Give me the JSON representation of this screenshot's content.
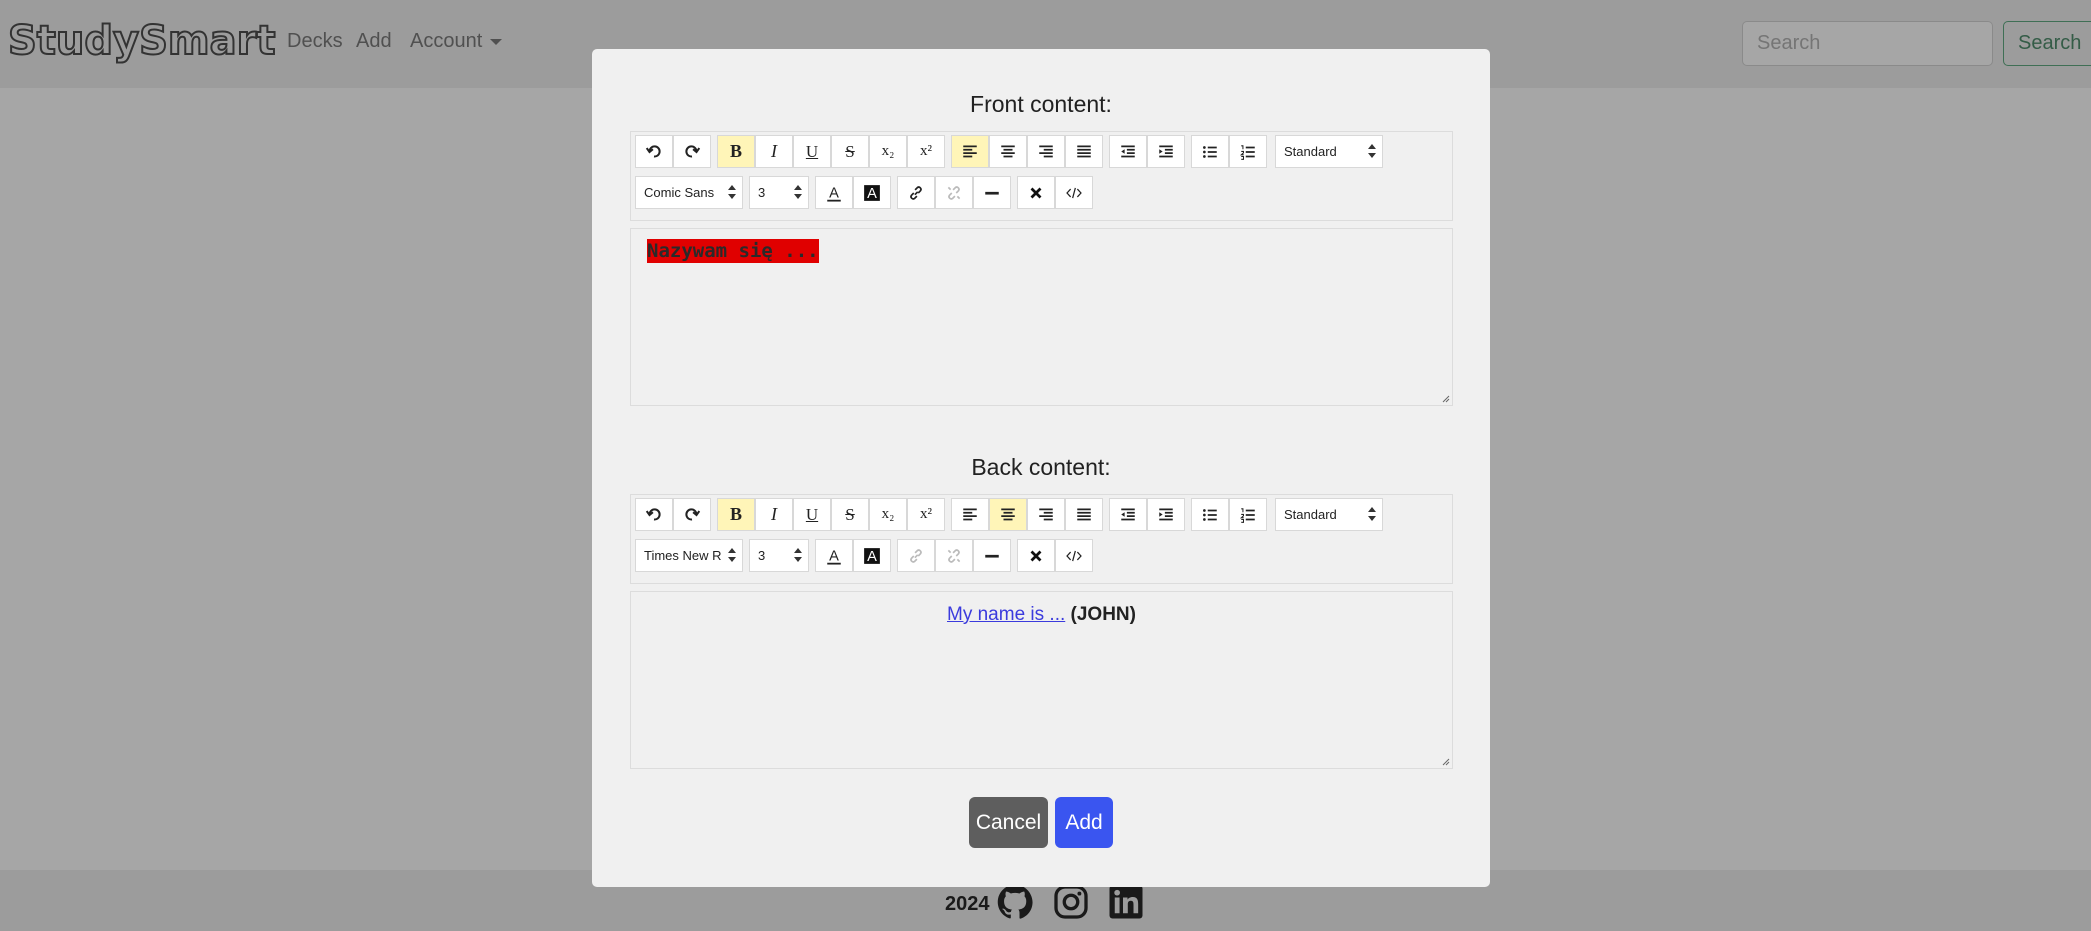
{
  "navbar": {
    "brand": "StudySmart",
    "links": [
      "Decks",
      "Add",
      "Account"
    ],
    "search_placeholder": "Search",
    "search_button": "Search"
  },
  "modal": {
    "front_title": "Front content:",
    "back_title": "Back content:",
    "front": {
      "font_select": "Comic Sans",
      "size_select": "3",
      "format_select": "Standard",
      "content": "Nazywam się ...",
      "content_highlight_color": "#e00000",
      "active_buttons": [
        "bold",
        "align-left"
      ]
    },
    "back": {
      "font_select": "Times New R",
      "size_select": "3",
      "format_select": "Standard",
      "content_link": "My name is ...",
      "content_bold": "(JOHN)",
      "active_buttons": [
        "bold",
        "align-center"
      ]
    },
    "cancel_label": "Cancel",
    "add_label": "Add"
  },
  "footer": {
    "year": "2024",
    "icons": [
      "github-icon",
      "instagram-icon",
      "linkedin-icon"
    ]
  },
  "colors": {
    "add_button": "#3a55f0",
    "cancel_button": "#5e5e5e",
    "active_tool": "#fff5b8",
    "link": "#3b3bdd"
  }
}
